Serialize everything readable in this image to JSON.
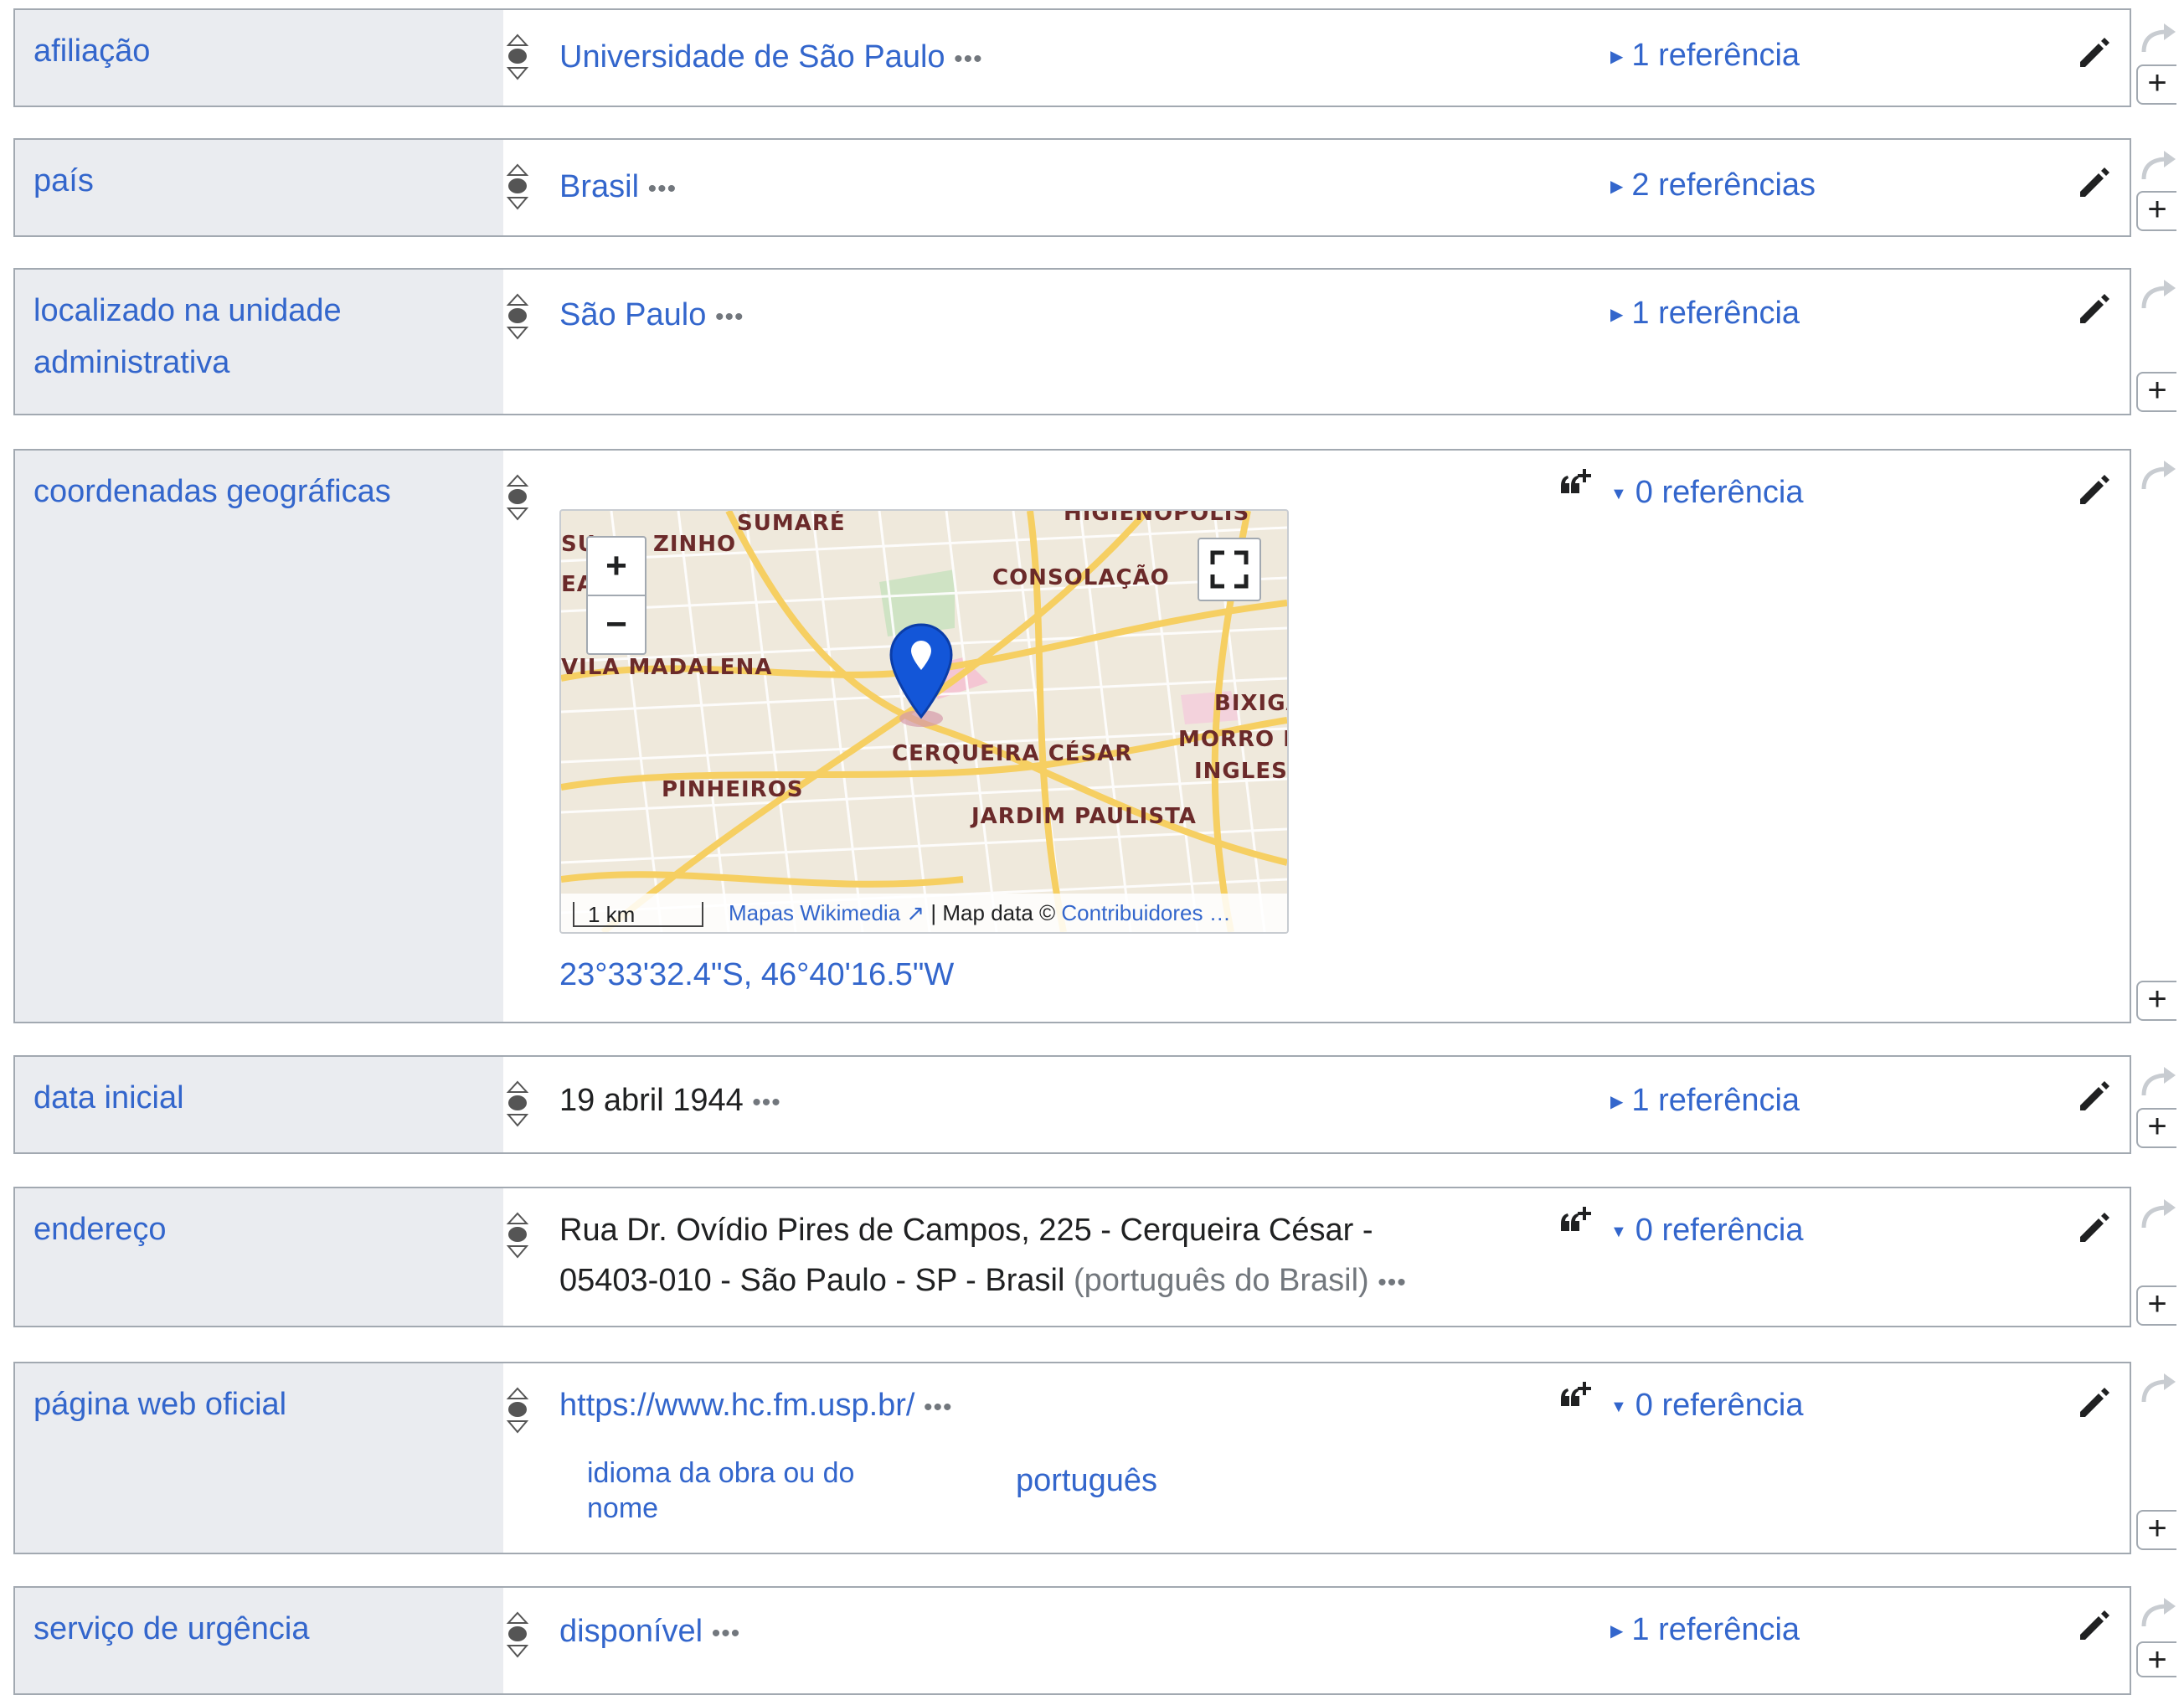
{
  "statements": [
    {
      "property": "afiliação",
      "value": "Universidade de São Paulo",
      "value_kind": "link",
      "references": "1 referência",
      "refs_state": "collapsed"
    },
    {
      "property": "país",
      "value": "Brasil",
      "value_kind": "link",
      "references": "2 referências",
      "refs_state": "collapsed"
    },
    {
      "property": "localizado na unidade administrativa",
      "value": "São Paulo",
      "value_kind": "link",
      "references": "1 referência",
      "refs_state": "collapsed"
    },
    {
      "property": "coordenadas geográficas",
      "value": "23°33'32.4\"S, 46°40'16.5\"W",
      "value_kind": "link",
      "references": "0 referência",
      "refs_state": "expanded"
    },
    {
      "property": "data inicial",
      "value": "19 abril 1944",
      "value_kind": "text",
      "references": "1 referência",
      "refs_state": "collapsed"
    },
    {
      "property": "endereço",
      "value_line1": "Rua Dr. Ovídio Pires de Campos, 225 - Cerqueira César -",
      "value_line2": "05403-010 - São Paulo - SP - Brasil",
      "language": "(português do Brasil)",
      "value_kind": "text",
      "references": "0 referência",
      "refs_state": "expanded"
    },
    {
      "property": "página web oficial",
      "value": "https://www.hc.fm.usp.br/",
      "value_kind": "link",
      "references": "0 referência",
      "refs_state": "expanded",
      "qualifier_property": "idioma da obra ou do nome",
      "qualifier_value": "português"
    },
    {
      "property": "serviço de urgência",
      "value": "disponível",
      "value_kind": "link",
      "references": "1 referência",
      "refs_state": "collapsed"
    }
  ],
  "map": {
    "neighborhood_labels": [
      "SUMARÉ",
      "ZINHO",
      "SU",
      "EA",
      "HIGIENÓPOLIS",
      "CONSOLAÇÃO",
      "VILA MADALENA",
      "BIXIGA",
      "MORRO D",
      "INGLESI",
      "CERQUEIRA CÉSAR",
      "PINHEIROS",
      "JARDIM PAULISTA"
    ],
    "zoom_in": "+",
    "zoom_out": "−",
    "scale": "1 km",
    "attribution_link": "Mapas Wikimedia",
    "attribution_text": " | Map data © ",
    "attribution_link2": "Contribuidores …"
  },
  "ui": {
    "more_dots": "•••",
    "add_symbol": "+"
  },
  "colors": {
    "link": "#3366cc",
    "property_bg": "#eaecf0",
    "border": "#a2a9b1",
    "marker": "#1356d8"
  },
  "icons": [
    "rank-normal-icon",
    "pencil-icon",
    "redo-arrow-icon",
    "add-reference-icon",
    "map-marker-icon",
    "fullscreen-icon",
    "triangle-right-icon",
    "triangle-down-icon"
  ]
}
